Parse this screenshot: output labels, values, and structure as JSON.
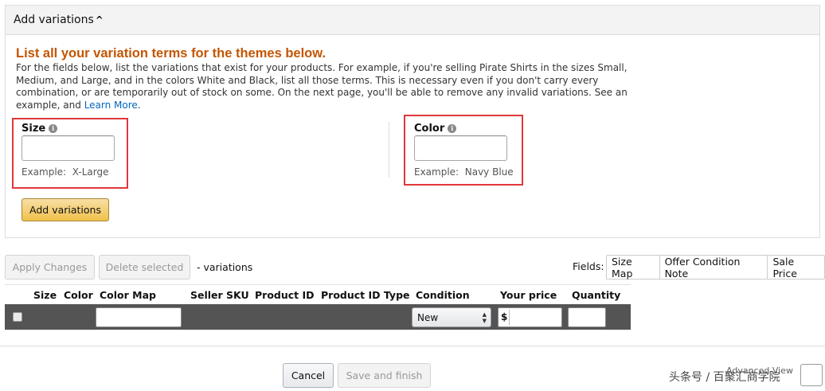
{
  "panel": {
    "title": "Add variations",
    "caret": "^",
    "heading": "List all your variation terms for the themes below.",
    "description": "For the fields below, list the variations that exist for your products. For example, if you're selling Pirate Shirts in the sizes Small, Medium, and Large, and in the colors White and Black, list all those terms. This is necessary even if you don't carry every combination, or are temporarily out of stock on some. On the next page, you'll be able to remove any invalid variations. See an example, and",
    "learn_more": "Learn More",
    "period": ".",
    "size": {
      "label": "Size",
      "value": "",
      "example_label": "Example:",
      "example_value": "X-Large"
    },
    "color": {
      "label": "Color",
      "value": "",
      "example_label": "Example:",
      "example_value": "Navy Blue"
    },
    "add_button": "Add variations"
  },
  "toolbar": {
    "apply_changes": "Apply Changes",
    "delete_selected": "Delete selected",
    "variations_count": "- variations",
    "fields_label": "Fields:",
    "tabs": [
      "Size Map",
      "Offer Condition Note",
      "Sale Price"
    ]
  },
  "table": {
    "headers": [
      "Size",
      "Color",
      "Color Map",
      "Seller SKU",
      "Product ID",
      "Product ID Type",
      "Condition",
      "Your price",
      "Quantity"
    ],
    "row": {
      "color_map": "",
      "condition": "New",
      "currency": "$",
      "price": "",
      "quantity": ""
    }
  },
  "footer": {
    "cancel": "Cancel",
    "save_and_finish": "Save and finish",
    "advanced_view": "Advanced View",
    "watermark": "头条号 / 百聚汇商学院"
  },
  "colors": {
    "heading": "#c45500",
    "highlight": "#e0383a",
    "row_bg": "#545454",
    "accent_button": "#f0c14b"
  }
}
